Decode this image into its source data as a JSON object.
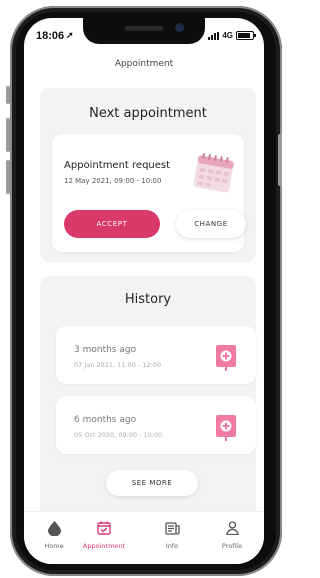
{
  "status_bar": {
    "time": "18:06",
    "network": "4G"
  },
  "header": {
    "title": "Appointment"
  },
  "next_appointment": {
    "section_title": "Next appointment",
    "title": "Appointment request",
    "date": "12 May 2021, 09:00 - 10:00",
    "accept_label": "ACCEPT",
    "change_label": "CHANGE"
  },
  "history": {
    "section_title": "History",
    "items": [
      {
        "ago": "3 months ago",
        "date": "07 Jan 2021, 11:00 - 12:00"
      },
      {
        "ago": "6 months ago",
        "date": "05 Oct 2020, 09:00 - 10:00"
      }
    ],
    "see_more_label": "SEE MORE"
  },
  "tabbar": {
    "tabs": [
      {
        "label": "Home",
        "icon": "drop-icon"
      },
      {
        "label": "Appointment",
        "icon": "calendar-check-icon",
        "active": true
      },
      {
        "label": "Info",
        "icon": "newspaper-icon"
      },
      {
        "label": "Profile",
        "icon": "person-icon"
      }
    ]
  },
  "colors": {
    "accent": "#d9386a",
    "pin": "#f07aa0",
    "card_bg": "#f3f3f3"
  }
}
